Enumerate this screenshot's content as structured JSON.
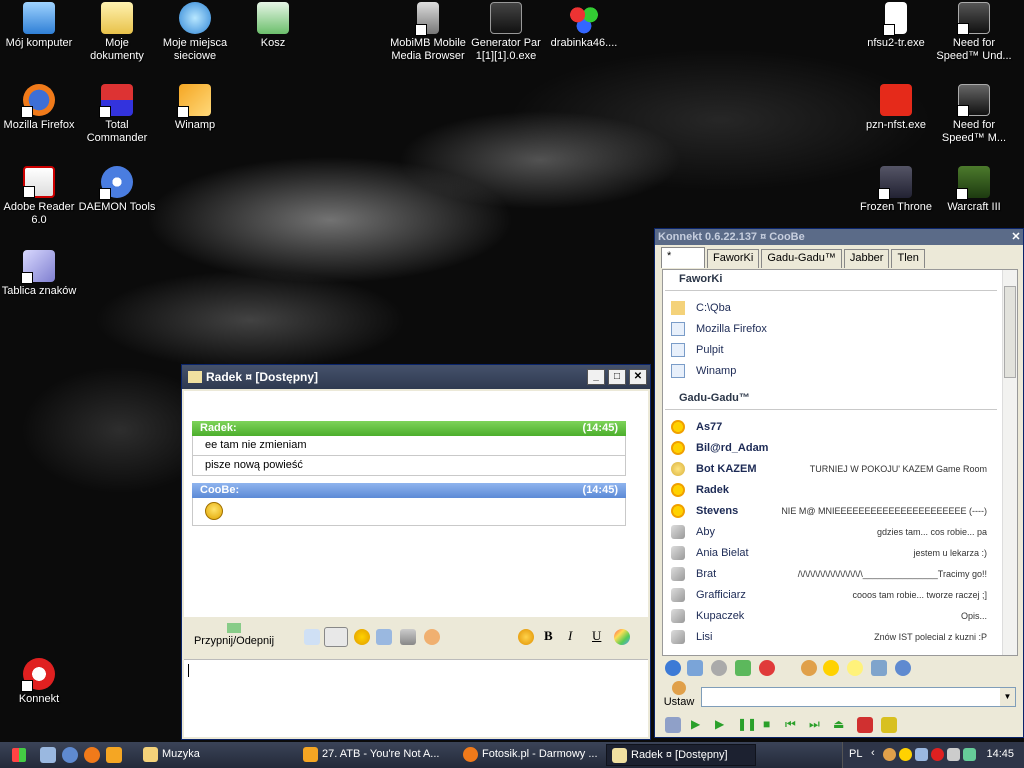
{
  "desktop": {
    "icons": [
      {
        "label": "Mój komputer"
      },
      {
        "label": "Moje dokumenty"
      },
      {
        "label": "Moje miejsca sieciowe"
      },
      {
        "label": "Kosz"
      },
      {
        "label": "MobiMB Mobile Media Browser"
      },
      {
        "label": "Generator Par 1[1][1].0.exe"
      },
      {
        "label": "drabinka46...."
      },
      {
        "label": "nfsu2-tr.exe"
      },
      {
        "label": "Need for Speed™ Und..."
      },
      {
        "label": "Mozilla Firefox"
      },
      {
        "label": "Total Commander"
      },
      {
        "label": "Winamp"
      },
      {
        "label": "pzn-nfst.exe"
      },
      {
        "label": "Need for Speed™ M..."
      },
      {
        "label": "Adobe Reader 6.0"
      },
      {
        "label": "DAEMON Tools"
      },
      {
        "label": "Frozen Throne"
      },
      {
        "label": "Warcraft III"
      },
      {
        "label": "Tablica znaków"
      },
      {
        "label": "Konnekt"
      }
    ]
  },
  "chat": {
    "title": "Radek ¤ [Dostępny]",
    "messages": [
      {
        "sender": "Radek:",
        "time": "(14:45)",
        "lines": [
          "ee tam nie zmieniam",
          "pisze nową powieść"
        ]
      },
      {
        "sender": "CooBe:",
        "time": "(14:45)",
        "lines": []
      }
    ],
    "pin_label": "Przypnij/Odepnij",
    "format_bold": "B",
    "format_italic": "I",
    "format_underline": "U"
  },
  "konnekt": {
    "title": "Konnekt 0.6.22.137 ¤ CooBe",
    "tabs": [
      "*",
      "FaworKi",
      "Gadu-Gadu™",
      "Jabber",
      "Tlen"
    ],
    "favorites_header": "FaworKi",
    "favorites": [
      "C:\\Qba",
      "Mozilla Firefox",
      "Pulpit",
      "Winamp"
    ],
    "gg_header": "Gadu-Gadu™",
    "contacts": [
      {
        "name": "As77",
        "status": "",
        "bold": true
      },
      {
        "name": "Bil@rd_Adam",
        "status": "",
        "bold": true
      },
      {
        "name": "Bot KAZEM",
        "status": "TURNIEJ W POKOJU' KAZEM Game Room",
        "bold": true
      },
      {
        "name": "Radek",
        "status": "",
        "bold": true
      },
      {
        "name": "Stevens",
        "status": "NIE M@ MNIEEEEEEEEEEEEEEEEEEEEEE (----)",
        "bold": true
      },
      {
        "name": "Aby",
        "status": "gdzies tam... cos robie... pa",
        "bold": false
      },
      {
        "name": "Ania Bielat",
        "status": "jestem u lekarza :)",
        "bold": false
      },
      {
        "name": "Brat",
        "status": "/\\/\\/\\/\\/\\/\\/\\/\\/\\/\\/\\/\\/\\_______________Tracimy go!!",
        "bold": false
      },
      {
        "name": "Grafficiarz",
        "status": "cooos tam robie...    tworze raczej ;]",
        "bold": false
      },
      {
        "name": "Kupaczek",
        "status": "Opis...",
        "bold": false
      },
      {
        "name": "Lisi",
        "status": "Znów IST polecial z kuzni :P",
        "bold": false
      }
    ],
    "status_button_label": "Ustaw"
  },
  "taskbar": {
    "items": [
      {
        "label": "Muzyka"
      },
      {
        "label": "27. ATB - You're Not A..."
      },
      {
        "label": "Fotosik.pl - Darmowy ..."
      },
      {
        "label": "Radek ¤ [Dostępny]"
      }
    ],
    "language": "PL",
    "clock": "14:45"
  }
}
